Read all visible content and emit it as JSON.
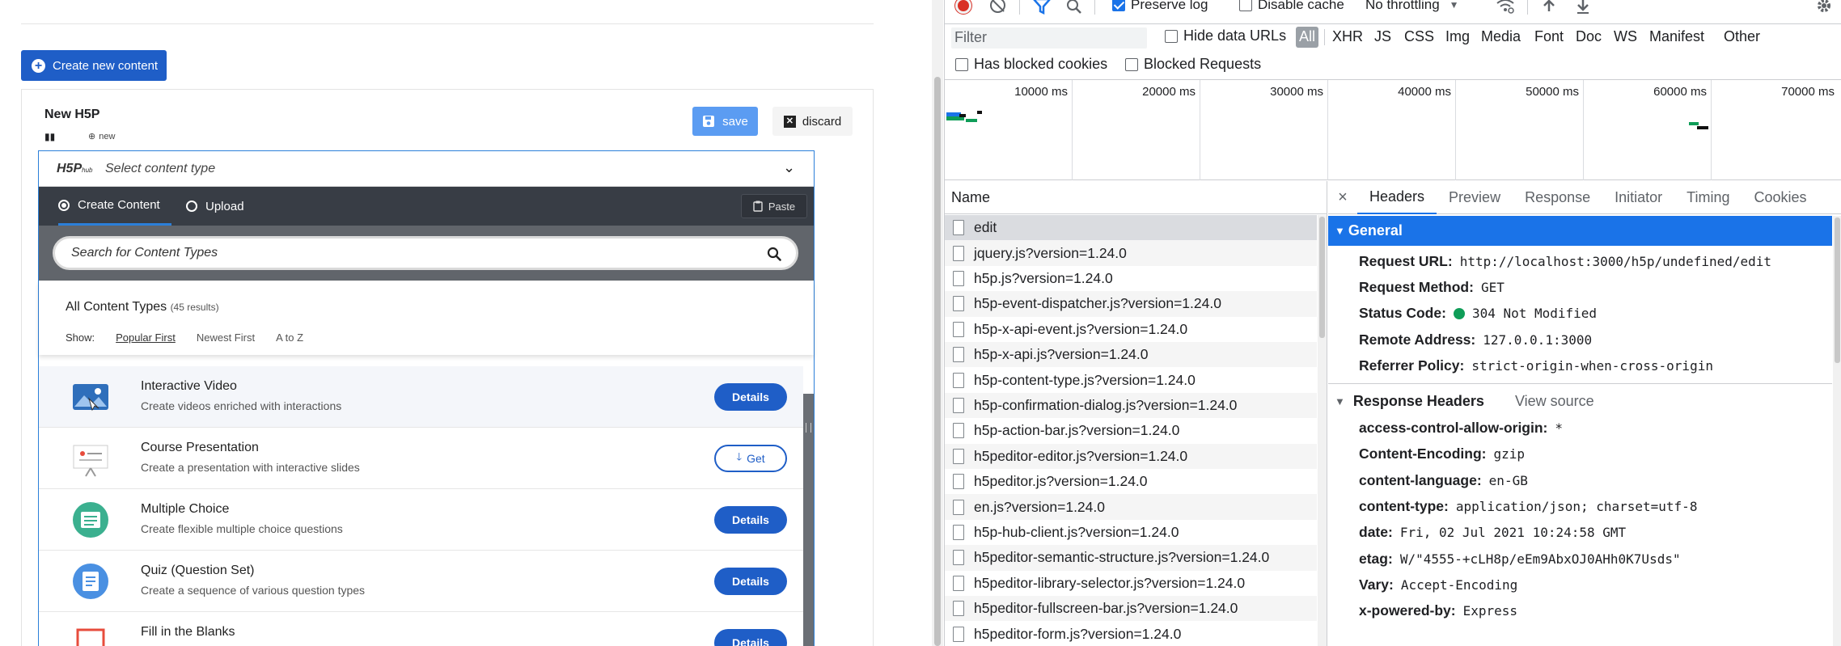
{
  "left": {
    "create_button": "Create new content",
    "editor": {
      "title": "New H5P",
      "badge": "new",
      "save": "save",
      "discard": "discard"
    },
    "hub": {
      "logo": "H5P",
      "logo_sub": "hub",
      "select_placeholder": "Select content type",
      "tabs": [
        "Create Content",
        "Upload"
      ],
      "paste": "Paste",
      "search_placeholder": "Search for Content Types",
      "all_types": "All Content Types",
      "results": "(45 results)",
      "show_label": "Show:",
      "sort_options": [
        "Popular First",
        "Newest First",
        "A to Z"
      ],
      "items": [
        {
          "title": "Interactive Video",
          "desc": "Create videos enriched with interactions",
          "action": "Details"
        },
        {
          "title": "Course Presentation",
          "desc": "Create a presentation with interactive slides",
          "action": "Get"
        },
        {
          "title": "Multiple Choice",
          "desc": "Create flexible multiple choice questions",
          "action": "Details"
        },
        {
          "title": "Quiz (Question Set)",
          "desc": "Create a sequence of various question types",
          "action": "Details"
        },
        {
          "title": "Fill in the Blanks",
          "desc": "",
          "action": "Details"
        }
      ]
    }
  },
  "devtools": {
    "toolbar": {
      "preserve_log": "Preserve log",
      "disable_cache": "Disable cache",
      "throttling": "No throttling"
    },
    "filter": {
      "placeholder": "Filter",
      "hide_data_urls": "Hide data URLs",
      "types": [
        "All",
        "XHR",
        "JS",
        "CSS",
        "Img",
        "Media",
        "Font",
        "Doc",
        "WS",
        "Manifest",
        "Other"
      ],
      "has_blocked_cookies": "Has blocked cookies",
      "blocked_requests": "Blocked Requests"
    },
    "timeline_labels": [
      "10000 ms",
      "20000 ms",
      "30000 ms",
      "40000 ms",
      "50000 ms",
      "60000 ms",
      "70000 ms"
    ],
    "name_header": "Name",
    "requests": [
      "edit",
      "jquery.js?version=1.24.0",
      "h5p.js?version=1.24.0",
      "h5p-event-dispatcher.js?version=1.24.0",
      "h5p-x-api-event.js?version=1.24.0",
      "h5p-x-api.js?version=1.24.0",
      "h5p-content-type.js?version=1.24.0",
      "h5p-confirmation-dialog.js?version=1.24.0",
      "h5p-action-bar.js?version=1.24.0",
      "h5peditor-editor.js?version=1.24.0",
      "h5peditor.js?version=1.24.0",
      "en.js?version=1.24.0",
      "h5p-hub-client.js?version=1.24.0",
      "h5peditor-semantic-structure.js?version=1.24.0",
      "h5peditor-library-selector.js?version=1.24.0",
      "h5peditor-fullscreen-bar.js?version=1.24.0",
      "h5peditor-form.js?version=1.24.0"
    ],
    "detail_tabs": [
      "Headers",
      "Preview",
      "Response",
      "Initiator",
      "Timing",
      "Cookies"
    ],
    "general": {
      "title": "General",
      "rows": [
        {
          "k": "Request URL:",
          "v": "http://localhost:3000/h5p/undefined/edit"
        },
        {
          "k": "Request Method:",
          "v": "GET"
        },
        {
          "k": "Status Code:",
          "v": "304 Not Modified"
        },
        {
          "k": "Remote Address:",
          "v": "127.0.0.1:3000"
        },
        {
          "k": "Referrer Policy:",
          "v": "strict-origin-when-cross-origin"
        }
      ]
    },
    "response_headers": {
      "title": "Response Headers",
      "view_source": "View source",
      "rows": [
        {
          "k": "access-control-allow-origin:",
          "v": "*"
        },
        {
          "k": "Content-Encoding:",
          "v": "gzip"
        },
        {
          "k": "content-language:",
          "v": "en-GB"
        },
        {
          "k": "content-type:",
          "v": "application/json; charset=utf-8"
        },
        {
          "k": "date:",
          "v": "Fri, 02 Jul 2021 10:24:58 GMT"
        },
        {
          "k": "etag:",
          "v": "W/\"4555-+cLH8p/eEm9AbxOJ0AHh0K7Usds\""
        },
        {
          "k": "Vary:",
          "v": "Accept-Encoding"
        },
        {
          "k": "x-powered-by:",
          "v": "Express"
        }
      ]
    }
  }
}
